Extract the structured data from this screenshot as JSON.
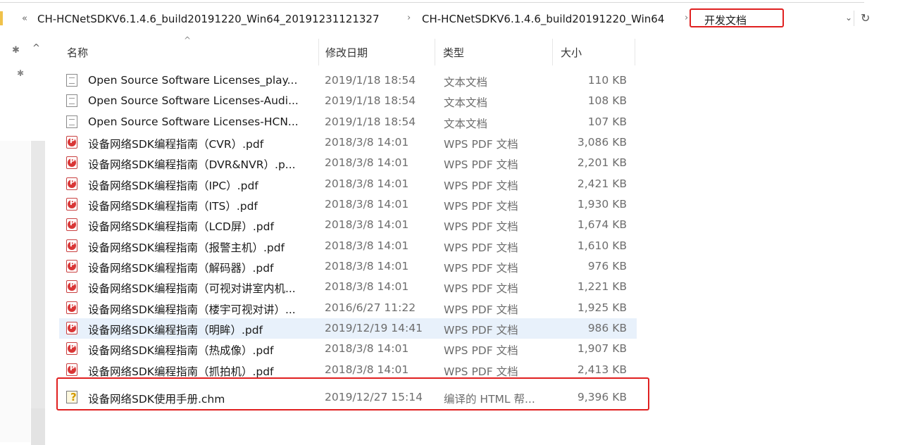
{
  "address_bar": {
    "more_glyph": "«",
    "crumbs": [
      "CH-HCNetSDKV6.1.4.6_build20191220_Win64_20191231121327",
      "CH-HCNetSDKV6.1.4.6_build20191220_Win64",
      "开发文档"
    ],
    "separator": "›",
    "dropdown_glyph": "⌄",
    "refresh_glyph": "↻"
  },
  "columns": {
    "name": "名称",
    "date": "修改日期",
    "type": "类型",
    "size": "大小"
  },
  "files": [
    {
      "icon": "text-file-icon",
      "name": "Open Source Software Licenses_play...",
      "date": "2019/1/18 18:54",
      "type": "文本文档",
      "size": "110 KB"
    },
    {
      "icon": "text-file-icon",
      "name": "Open Source Software Licenses-Audi...",
      "date": "2019/1/18 18:54",
      "type": "文本文档",
      "size": "108 KB"
    },
    {
      "icon": "text-file-icon",
      "name": "Open Source Software Licenses-HCN...",
      "date": "2019/1/18 18:54",
      "type": "文本文档",
      "size": "107 KB"
    },
    {
      "icon": "pdf-file-icon",
      "name": "设备网络SDK编程指南（CVR）.pdf",
      "date": "2018/3/8 14:01",
      "type": "WPS PDF 文档",
      "size": "3,086 KB"
    },
    {
      "icon": "pdf-file-icon",
      "name": "设备网络SDK编程指南（DVR&NVR）.p...",
      "date": "2018/3/8 14:01",
      "type": "WPS PDF 文档",
      "size": "2,201 KB"
    },
    {
      "icon": "pdf-file-icon",
      "name": "设备网络SDK编程指南（IPC）.pdf",
      "date": "2018/3/8 14:01",
      "type": "WPS PDF 文档",
      "size": "2,421 KB"
    },
    {
      "icon": "pdf-file-icon",
      "name": "设备网络SDK编程指南（ITS）.pdf",
      "date": "2018/3/8 14:01",
      "type": "WPS PDF 文档",
      "size": "1,930 KB"
    },
    {
      "icon": "pdf-file-icon",
      "name": "设备网络SDK编程指南（LCD屏）.pdf",
      "date": "2018/3/8 14:01",
      "type": "WPS PDF 文档",
      "size": "1,674 KB"
    },
    {
      "icon": "pdf-file-icon",
      "name": "设备网络SDK编程指南（报警主机）.pdf",
      "date": "2018/3/8 14:01",
      "type": "WPS PDF 文档",
      "size": "1,610 KB"
    },
    {
      "icon": "pdf-file-icon",
      "name": "设备网络SDK编程指南（解码器）.pdf",
      "date": "2018/3/8 14:01",
      "type": "WPS PDF 文档",
      "size": "976 KB"
    },
    {
      "icon": "pdf-file-icon",
      "name": "设备网络SDK编程指南（可视对讲室内机...",
      "date": "2018/3/8 14:01",
      "type": "WPS PDF 文档",
      "size": "1,221 KB"
    },
    {
      "icon": "pdf-file-icon",
      "name": "设备网络SDK编程指南（楼宇可视对讲）...",
      "date": "2016/6/27 11:22",
      "type": "WPS PDF 文档",
      "size": "1,925 KB"
    },
    {
      "icon": "pdf-file-icon",
      "name": "设备网络SDK编程指南（明眸）.pdf",
      "date": "2019/12/19 14:41",
      "type": "WPS PDF 文档",
      "size": "986 KB"
    },
    {
      "icon": "pdf-file-icon",
      "name": "设备网络SDK编程指南（热成像）.pdf",
      "date": "2018/3/8 14:01",
      "type": "WPS PDF 文档",
      "size": "1,907 KB"
    },
    {
      "icon": "pdf-file-icon",
      "name": "设备网络SDK编程指南（抓拍机）.pdf",
      "date": "2018/3/8 14:01",
      "type": "WPS PDF 文档",
      "size": "2,413 KB"
    },
    {
      "icon": "chm-file-icon",
      "name": "设备网络SDK使用手册.chm",
      "date": "2019/12/27 15:14",
      "type": "编译的 HTML 帮...",
      "size": "9,396 KB"
    }
  ],
  "selected_index": 12,
  "colors": {
    "highlight_box": "#e02020",
    "selection": "#e8f1fb"
  }
}
